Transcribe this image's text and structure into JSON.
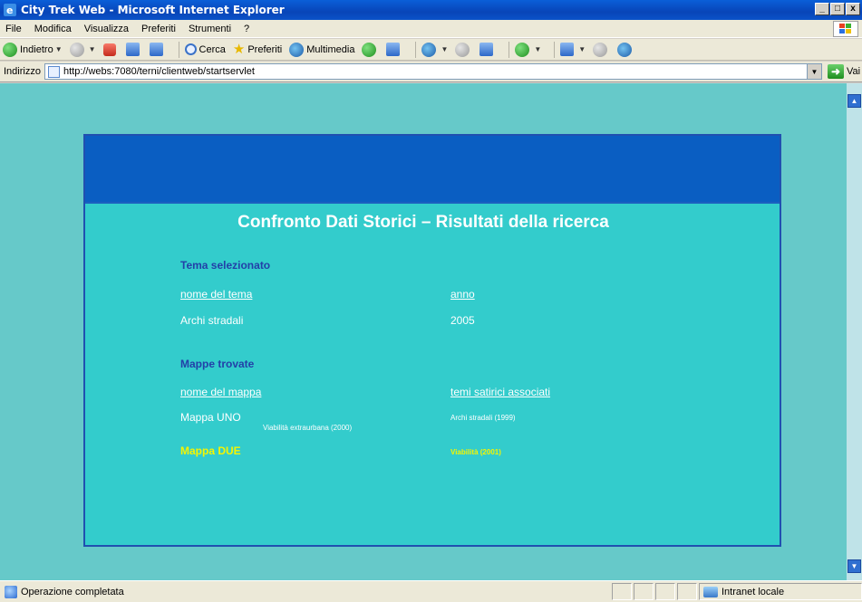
{
  "window": {
    "title": "City Trek Web - Microsoft Internet Explorer",
    "buttons": [
      "_",
      "□",
      "x"
    ]
  },
  "menu": [
    "File",
    "Modifica",
    "Visualizza",
    "Preferiti",
    "Strumenti",
    "?"
  ],
  "toolbar": {
    "back": "Indietro",
    "search": "Cerca",
    "favorites": "Preferiti",
    "media": "Multimedia"
  },
  "address": {
    "label": "Indirizzo",
    "url": "http://webs:7080/terni/clientweb/startservlet",
    "go": "Vai"
  },
  "page": {
    "title": "Confronto Dati Storici – Risultati della ricerca",
    "theme_section": "Tema selezionato",
    "theme_col1_header": "nome del tema",
    "theme_col2_header": "anno",
    "theme_row": {
      "name": "Archi stradali",
      "year": "2005"
    },
    "maps_section": "Mappe trovate",
    "maps_col1_header": "nome del mappa",
    "maps_col2_header": "temi satirici associati",
    "maps": [
      {
        "name": "Mappa UNO",
        "theme_a": "Viabilità extraurbana (2000)",
        "theme_b": "Archi stradali (1999)"
      },
      {
        "name": "Mappa DUE",
        "theme_b": "Viabilità (2001)"
      }
    ]
  },
  "status": {
    "text": "Operazione completata",
    "zone": "Intranet locale"
  },
  "colors": {
    "page_bg": "#66c9c9",
    "panel_bg": "#33cccc",
    "header_bg": "#0a5ec2",
    "section_text": "#2340a8",
    "highlight": "#f5f500"
  }
}
